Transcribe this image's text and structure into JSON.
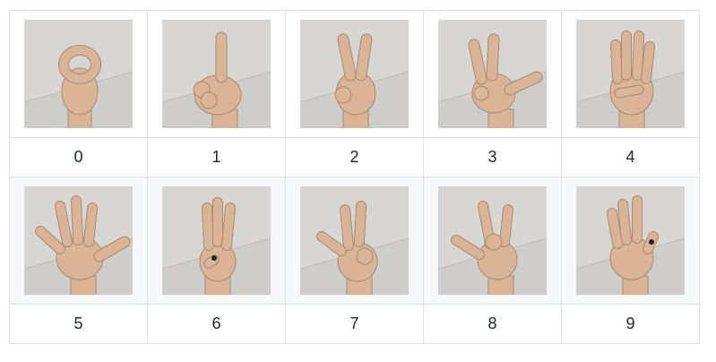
{
  "table": {
    "rows": [
      {
        "cells": [
          {
            "label": "0",
            "image": "hand-sign-0-image"
          },
          {
            "label": "1",
            "image": "hand-sign-1-image"
          },
          {
            "label": "2",
            "image": "hand-sign-2-image"
          },
          {
            "label": "3",
            "image": "hand-sign-3-image"
          },
          {
            "label": "4",
            "image": "hand-sign-4-image"
          }
        ]
      },
      {
        "cells": [
          {
            "label": "5",
            "image": "hand-sign-5-image"
          },
          {
            "label": "6",
            "image": "hand-sign-6-image"
          },
          {
            "label": "7",
            "image": "hand-sign-7-image"
          },
          {
            "label": "8",
            "image": "hand-sign-8-image"
          },
          {
            "label": "9",
            "image": "hand-sign-9-image"
          }
        ]
      }
    ]
  },
  "colors": {
    "border": "#dfe2e5",
    "alt_row_background": "#f6f8fa",
    "text": "#24292e",
    "skin": "#d9b497",
    "photo_background": "#cfcdca"
  }
}
